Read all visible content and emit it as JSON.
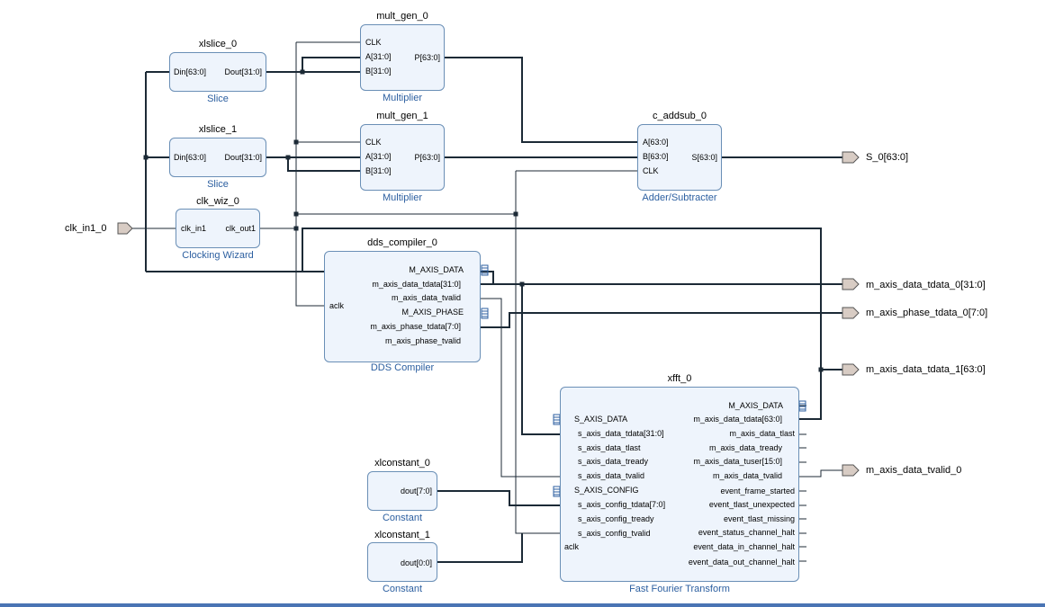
{
  "blocks": {
    "xlslice_0": {
      "name": "xlslice_0",
      "type": "Slice",
      "pins": [
        "Din[63:0]",
        "Dout[31:0]"
      ]
    },
    "xlslice_1": {
      "name": "xlslice_1",
      "type": "Slice",
      "pins": [
        "Din[63:0]",
        "Dout[31:0]"
      ]
    },
    "clk_wiz_0": {
      "name": "clk_wiz_0",
      "type": "Clocking Wizard",
      "pins": [
        "clk_in1",
        "clk_out1"
      ]
    },
    "mult_gen_0": {
      "name": "mult_gen_0",
      "type": "Multiplier",
      "pins": [
        "CLK",
        "A[31:0]",
        "B[31:0]",
        "P[63:0]"
      ]
    },
    "mult_gen_1": {
      "name": "mult_gen_1",
      "type": "Multiplier",
      "pins": [
        "CLK",
        "A[31:0]",
        "B[31:0]",
        "P[63:0]"
      ]
    },
    "c_addsub_0": {
      "name": "c_addsub_0",
      "type": "Adder/Subtracter",
      "pins": [
        "A[63:0]",
        "B[63:0]",
        "CLK",
        "S[63:0]"
      ]
    },
    "dds_compiler_0": {
      "name": "dds_compiler_0",
      "type": "DDS Compiler",
      "pins": [
        "aclk",
        "M_AXIS_DATA",
        "m_axis_data_tdata[31:0]",
        "m_axis_data_tvalid",
        "M_AXIS_PHASE",
        "m_axis_phase_tdata[7:0]",
        "m_axis_phase_tvalid"
      ]
    },
    "xfft_0": {
      "name": "xfft_0",
      "type": "Fast Fourier Transform",
      "left_pins": [
        "S_AXIS_DATA",
        "s_axis_data_tdata[31:0]",
        "s_axis_data_tlast",
        "s_axis_data_tready",
        "s_axis_data_tvalid",
        "S_AXIS_CONFIG",
        "s_axis_config_tdata[7:0]",
        "s_axis_config_tready",
        "s_axis_config_tvalid",
        "aclk"
      ],
      "right_pins": [
        "M_AXIS_DATA",
        "m_axis_data_tdata[63:0]",
        "m_axis_data_tlast",
        "m_axis_data_tready",
        "m_axis_data_tuser[15:0]",
        "m_axis_data_tvalid",
        "event_frame_started",
        "event_tlast_unexpected",
        "event_tlast_missing",
        "event_status_channel_halt",
        "event_data_in_channel_halt",
        "event_data_out_channel_halt"
      ]
    },
    "xlconstant_0": {
      "name": "xlconstant_0",
      "type": "Constant",
      "pins": [
        "dout[7:0]"
      ]
    },
    "xlconstant_1": {
      "name": "xlconstant_1",
      "type": "Constant",
      "pins": [
        "dout[0:0]"
      ]
    }
  },
  "ports": {
    "clk_in1_0": "clk_in1_0",
    "S_0": "S_0[63:0]",
    "m_axis_data_tdata_0": "m_axis_data_tdata_0[31:0]",
    "m_axis_phase_tdata_0": "m_axis_phase_tdata_0[7:0]",
    "m_axis_data_tdata_1": "m_axis_data_tdata_1[63:0]",
    "m_axis_data_tvalid_0": "m_axis_data_tvalid_0"
  },
  "colors": {
    "block_fill": "#eef4fc",
    "block_border": "#6a8fb6",
    "wire": "#1c2a36",
    "subtitle": "#2c5fa0",
    "port_fill": "#d8ccc4",
    "bottom_bar": "#4a74b4"
  }
}
